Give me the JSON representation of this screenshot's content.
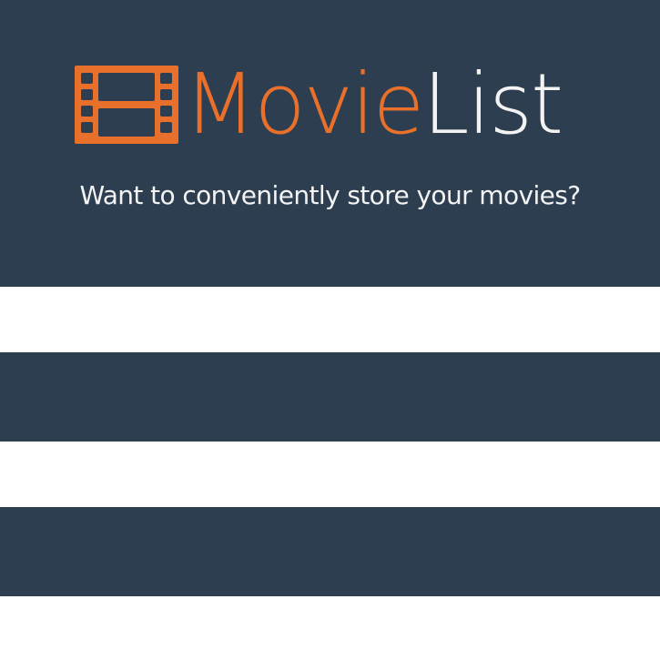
{
  "colors": {
    "navy": "#2c3e50",
    "orange": "#e8702a",
    "white": "#ffffff",
    "logo_list_text": "#f3f3f3"
  },
  "header": {
    "logo": {
      "icon": "film-strip-icon",
      "word_orange": "Movie",
      "word_white": "List"
    },
    "tagline": "Want to conveniently store your movies?"
  },
  "bands": [
    "white",
    "navy",
    "white",
    "navy",
    "white"
  ]
}
